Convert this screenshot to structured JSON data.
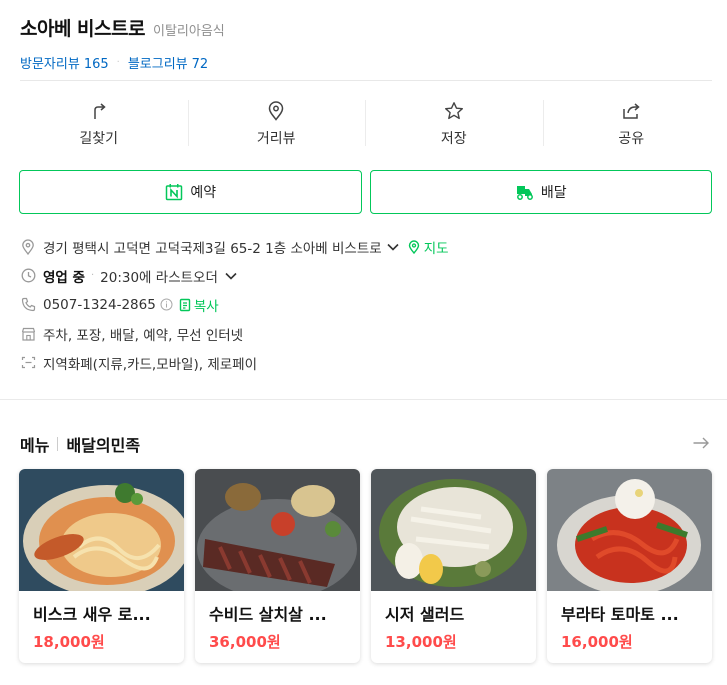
{
  "place": {
    "name": "소아베 비스트로",
    "category": "이탈리아음식"
  },
  "reviews": {
    "visitor_label": "방문자리뷰",
    "visitor_count": "165",
    "blog_label": "블로그리뷰",
    "blog_count": "72"
  },
  "actions": [
    {
      "label": "길찾기",
      "icon": "directions-icon"
    },
    {
      "label": "거리뷰",
      "icon": "location-pin-icon"
    },
    {
      "label": "저장",
      "icon": "star-icon"
    },
    {
      "label": "공유",
      "icon": "share-icon"
    }
  ],
  "buttons": {
    "reserve": "예약",
    "delivery": "배달"
  },
  "info": {
    "address": "경기 평택시 고덕면 고덕국제3길 65-2 1층 소아베 비스트로",
    "map_label": "지도",
    "status": "영업 중",
    "last_order": "20:30에 라스트오더",
    "phone": "0507-1324-2865",
    "copy_label": "복사",
    "amenities": "주차, 포장, 배달, 예약, 무선 인터넷",
    "payment": "지역화폐(지류,카드,모바일), 제로페이"
  },
  "menu_section": {
    "tab1": "메뉴",
    "tab2": "배달의민족"
  },
  "menu_items": [
    {
      "name": "비스크 새우 로...",
      "price": "18,000원"
    },
    {
      "name": "수비드 살치살 ...",
      "price": "36,000원"
    },
    {
      "name": "시저 샐러드",
      "price": "13,000원"
    },
    {
      "name": "부라타 토마토 ...",
      "price": "16,000원"
    }
  ],
  "colors": {
    "accent": "#03c75a",
    "link": "#0068c3",
    "price": "#ff4b4b"
  }
}
